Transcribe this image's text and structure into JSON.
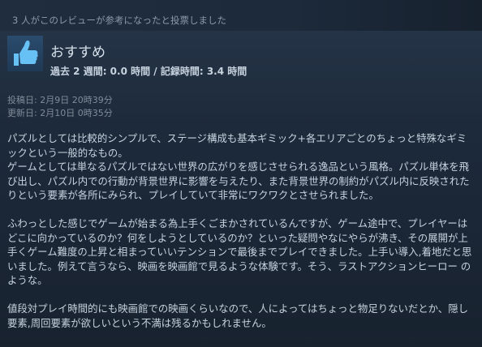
{
  "helpful_count_text": "3 人がこのレビューが参考になったと投票しました",
  "review": {
    "recommendation": "おすすめ",
    "playtime": "過去 2 週間: 0.0 時間 / 記録時間: 3.4 時間",
    "posted": "投稿日: 2月9日 20時39分",
    "updated": "更新日: 2月10日 0時35分",
    "paragraphs": [
      "パズルとしては比較的シンプルで、ステージ構成も基本ギミック+各エリアごとのちょっと特殊なギミックという一般的なもの。",
      "ゲームとしては単なるパズルではない世界の広がりを感じさせられる逸品という風格。パズル単体を飛び出し、パズル内での行動が背景世界に影響を与えたり、また背景世界の制約がパズル内に反映されたりという要素が各所にみられ、プレイしていて非常にワクワクとさせられました。",
      "ふわっとした感じでゲームが始まる為上手くごまかされているんですが、ゲーム途中で、プレイヤーはどこに向かっているのか？何をしようとしているのか？といった疑問やなにやらが沸き、その展開が上手くゲーム難度の上昇と相まっていいテンションで最後までプレイできました。上手い導入,着地だと思いました。例えて言うなら、映画を映画館で見るような体験です。そう、ラストアクションヒーロー のような。",
      "値段対プレイ時間的にも映画館での映画くらいなので、人によってはちょっと物足りないだとか、隠し要素,周回要素が欲しいという不満は残るかもしれません。"
    ]
  },
  "icon": "thumbs-up-icon",
  "colors": {
    "background": "#1b2636",
    "thumb": "#67c1f5",
    "text": "#c6d4df"
  }
}
